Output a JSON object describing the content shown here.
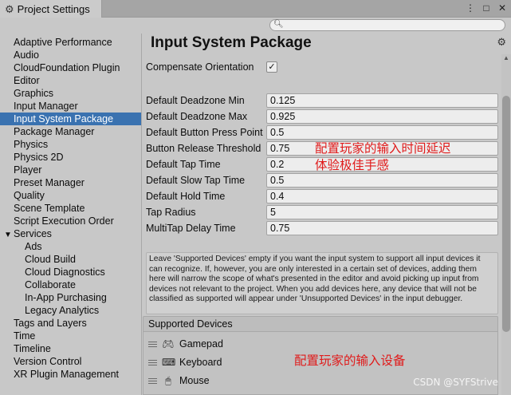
{
  "window": {
    "tab_title": "Project Settings",
    "tab_icon": "gear-icon",
    "controls": [
      "⋮",
      "□",
      "✕"
    ]
  },
  "search": {
    "placeholder": "",
    "value": ""
  },
  "sidebar": {
    "items": [
      {
        "label": "Adaptive Performance",
        "kind": "item"
      },
      {
        "label": "Audio",
        "kind": "item"
      },
      {
        "label": "CloudFoundation Plugin",
        "kind": "item"
      },
      {
        "label": "Editor",
        "kind": "item"
      },
      {
        "label": "Graphics",
        "kind": "item"
      },
      {
        "label": "Input Manager",
        "kind": "item"
      },
      {
        "label": "Input System Package",
        "kind": "item",
        "selected": true
      },
      {
        "label": "Package Manager",
        "kind": "item"
      },
      {
        "label": "Physics",
        "kind": "item"
      },
      {
        "label": "Physics 2D",
        "kind": "item"
      },
      {
        "label": "Player",
        "kind": "item"
      },
      {
        "label": "Preset Manager",
        "kind": "item"
      },
      {
        "label": "Quality",
        "kind": "item"
      },
      {
        "label": "Scene Template",
        "kind": "item"
      },
      {
        "label": "Script Execution Order",
        "kind": "item"
      },
      {
        "label": "Services",
        "kind": "group"
      },
      {
        "label": "Ads",
        "kind": "sub"
      },
      {
        "label": "Cloud Build",
        "kind": "sub"
      },
      {
        "label": "Cloud Diagnostics",
        "kind": "sub"
      },
      {
        "label": "Collaborate",
        "kind": "sub"
      },
      {
        "label": "In-App Purchasing",
        "kind": "sub"
      },
      {
        "label": "Legacy Analytics",
        "kind": "sub"
      },
      {
        "label": "Tags and Layers",
        "kind": "item"
      },
      {
        "label": "Time",
        "kind": "item"
      },
      {
        "label": "Timeline",
        "kind": "item"
      },
      {
        "label": "Version Control",
        "kind": "item"
      },
      {
        "label": "XR Plugin Management",
        "kind": "item"
      }
    ]
  },
  "main": {
    "title": "Input System Package",
    "compensate": {
      "label": "Compensate Orientation",
      "checked": true,
      "check_glyph": "✓"
    },
    "properties": [
      {
        "label": "Default Deadzone Min",
        "value": "0.125"
      },
      {
        "label": "Default Deadzone Max",
        "value": "0.925"
      },
      {
        "label": "Default Button Press Point",
        "value": "0.5"
      },
      {
        "label": "Button Release Threshold",
        "value": "0.75"
      },
      {
        "label": "Default Tap Time",
        "value": "0.2"
      },
      {
        "label": "Default Slow Tap Time",
        "value": "0.5"
      },
      {
        "label": "Default Hold Time",
        "value": "0.4"
      },
      {
        "label": "Tap Radius",
        "value": "5"
      },
      {
        "label": "MultiTap Delay Time",
        "value": "0.75"
      }
    ],
    "help_text": "Leave 'Supported Devices' empty if you want the input system to support all input devices it can recognize. If, however, you are only interested in a certain set of devices, adding them here will narrow the scope of what's presented in the editor and avoid picking up input from devices not relevant to the project. When you add devices here, any device that will not be classified as supported will appear under 'Unsupported Devices' in the input debugger.",
    "supported_devices": {
      "header": "Supported Devices",
      "items": [
        {
          "label": "Gamepad",
          "icon": "gamepad-icon"
        },
        {
          "label": "Keyboard",
          "icon": "keyboard-icon"
        },
        {
          "label": "Mouse",
          "icon": "mouse-icon"
        }
      ]
    }
  },
  "annotations": {
    "line1": "配置玩家的输入时间延迟",
    "line2": "体验极佳手感",
    "line3": "配置玩家的输入设备",
    "color": "#e01b1b"
  },
  "watermark": "CSDN @SYFStrive"
}
